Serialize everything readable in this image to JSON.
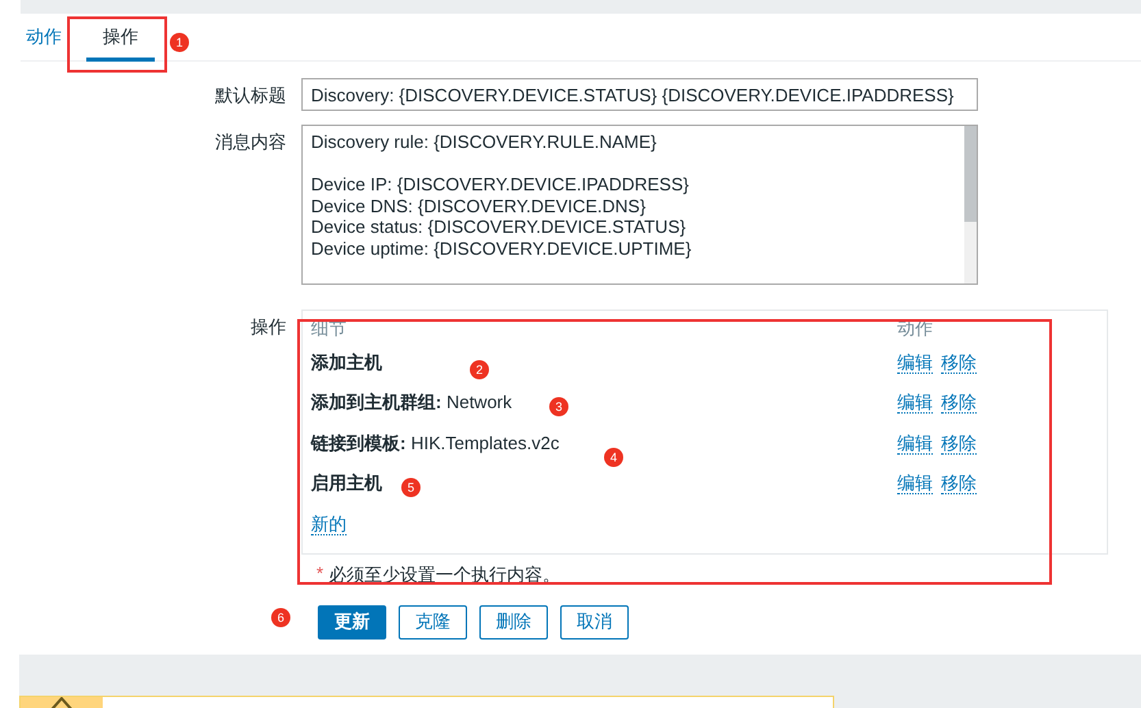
{
  "tabs": [
    {
      "label": "动作",
      "selected": false
    },
    {
      "label": "操作",
      "selected": true
    }
  ],
  "form": {
    "default_subject": {
      "label": "默认标题",
      "value": "Discovery: {DISCOVERY.DEVICE.STATUS} {DISCOVERY.DEVICE.IPADDRESS}"
    },
    "message": {
      "label": "消息内容",
      "paragraphs": [
        [
          "Discovery rule: {DISCOVERY.RULE.NAME}"
        ],
        [
          "Device IP: {DISCOVERY.DEVICE.IPADDRESS}",
          "Device DNS: {DISCOVERY.DEVICE.DNS}",
          "Device status: {DISCOVERY.DEVICE.STATUS}",
          "Device uptime: {DISCOVERY.DEVICE.UPTIME}"
        ]
      ]
    },
    "operations": {
      "label": "操作",
      "columns": [
        "细节",
        "动作"
      ],
      "rows": [
        {
          "label": "添加主机",
          "actions": [
            "编辑",
            "移除"
          ]
        },
        {
          "label": "添加到主机群组:",
          "value": "Network",
          "actions": [
            "编辑",
            "移除"
          ]
        },
        {
          "label": "链接到模板:",
          "value": "HIK.Templates.v2c",
          "actions": [
            "编辑",
            "移除"
          ]
        },
        {
          "label": "启用主机",
          "actions": [
            "编辑",
            "移除"
          ]
        }
      ],
      "new_link": "新的"
    },
    "required_note": {
      "mark": "*",
      "text": "必须至少设置一个执行内容。"
    }
  },
  "buttons": [
    {
      "label": "更新",
      "kind": "primary"
    },
    {
      "label": "克隆",
      "kind": "secondary"
    },
    {
      "label": "删除",
      "kind": "secondary"
    },
    {
      "label": "取消",
      "kind": "secondary"
    }
  ],
  "annotations": [
    "1",
    "2",
    "3",
    "4",
    "5",
    "6"
  ]
}
